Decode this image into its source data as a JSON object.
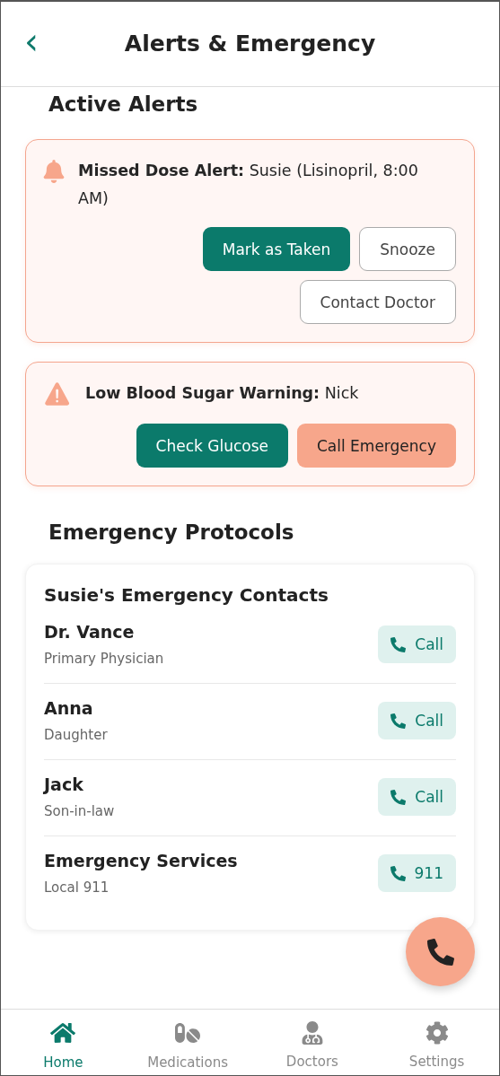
{
  "header": {
    "back": "‹",
    "title": "Alerts & Emergency"
  },
  "active_alerts": {
    "title": "Active Alerts",
    "alerts": [
      {
        "kind": "bell",
        "text": "**Missed Dose Alert:** Susie (Lisinopril, 8:00 AM)",
        "actions": [
          {
            "label": "Mark as Taken",
            "kind": "primary"
          },
          {
            "label": "Snooze",
            "kind": "outline"
          },
          {
            "label": "Contact Doctor",
            "kind": "outline"
          }
        ]
      },
      {
        "kind": "warning",
        "text": "**Low Blood Sugar Warning:** Nick",
        "actions": [
          {
            "label": "Check Glucose",
            "kind": "primary"
          },
          {
            "label": "Call Emergency",
            "kind": "accent"
          }
        ]
      }
    ]
  },
  "protocols": {
    "title": "Emergency Protocols",
    "card_title": "Susie's Emergency Contacts",
    "contacts": [
      {
        "name": "Dr. Vance",
        "role": "Primary Physician",
        "action": "Call"
      },
      {
        "name": "Anna",
        "role": "Daughter",
        "action": "Call"
      },
      {
        "name": "Jack",
        "role": "Son-in-law",
        "action": "Call"
      },
      {
        "name": "Emergency Services",
        "role": "Local 911",
        "action": "911"
      }
    ]
  },
  "nav": [
    {
      "label": "Home",
      "kind": "home",
      "selected": true
    },
    {
      "label": "Medications",
      "kind": "pills",
      "selected": false
    },
    {
      "label": "Doctors",
      "kind": "doctor",
      "selected": false
    },
    {
      "label": "Settings",
      "kind": "settings",
      "selected": false
    }
  ]
}
